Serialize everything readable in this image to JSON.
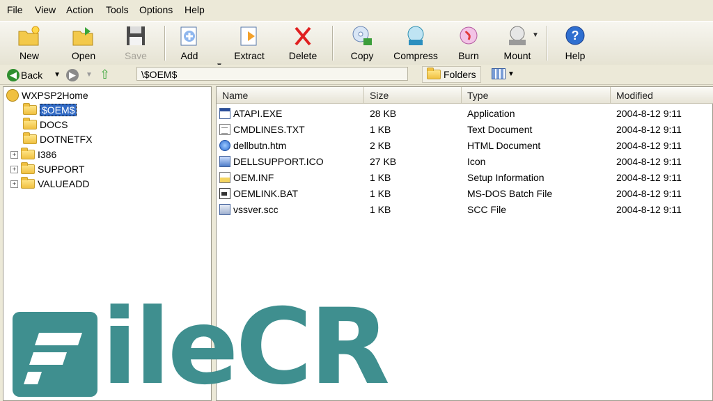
{
  "menu": [
    "File",
    "View",
    "Action",
    "Tools",
    "Options",
    "Help"
  ],
  "toolbar": {
    "new": "New",
    "open": "Open",
    "save": "Save",
    "add": "Add",
    "extract": "Extract",
    "delete": "Delete",
    "copy": "Copy",
    "compress": "Compress",
    "burn": "Burn",
    "mount": "Mount",
    "help": "Help"
  },
  "nav": {
    "back": "Back",
    "address": "\\$OEM$",
    "folders": "Folders"
  },
  "tree": {
    "root": "WXPSP2Home",
    "items": [
      "$OEM$",
      "DOCS",
      "DOTNETFX",
      "I386",
      "SUPPORT",
      "VALUEADD"
    ]
  },
  "columns": {
    "name": "Name",
    "size": "Size",
    "type": "Type",
    "modified": "Modified"
  },
  "files": [
    {
      "name": "ATAPI.EXE",
      "size": "28 KB",
      "type": "Application",
      "modified": "2004-8-12 9:11",
      "icon": "exe"
    },
    {
      "name": "CMDLINES.TXT",
      "size": "1 KB",
      "type": "Text Document",
      "modified": "2004-8-12 9:11",
      "icon": "txt"
    },
    {
      "name": "dellbutn.htm",
      "size": "2 KB",
      "type": "HTML Document",
      "modified": "2004-8-12 9:11",
      "icon": "htm"
    },
    {
      "name": "DELLSUPPORT.ICO",
      "size": "27 KB",
      "type": "Icon",
      "modified": "2004-8-12 9:11",
      "icon": "ico"
    },
    {
      "name": "OEM.INF",
      "size": "1 KB",
      "type": "Setup Information",
      "modified": "2004-8-12 9:11",
      "icon": "inf"
    },
    {
      "name": "OEMLINK.BAT",
      "size": "1 KB",
      "type": "MS-DOS Batch File",
      "modified": "2004-8-12 9:11",
      "icon": "bat"
    },
    {
      "name": "vssver.scc",
      "size": "1 KB",
      "type": "SCC File",
      "modified": "2004-8-12 9:11",
      "icon": "scc"
    }
  ],
  "watermark": {
    "text": "ileCR",
    "color": "#3f8f8f"
  }
}
